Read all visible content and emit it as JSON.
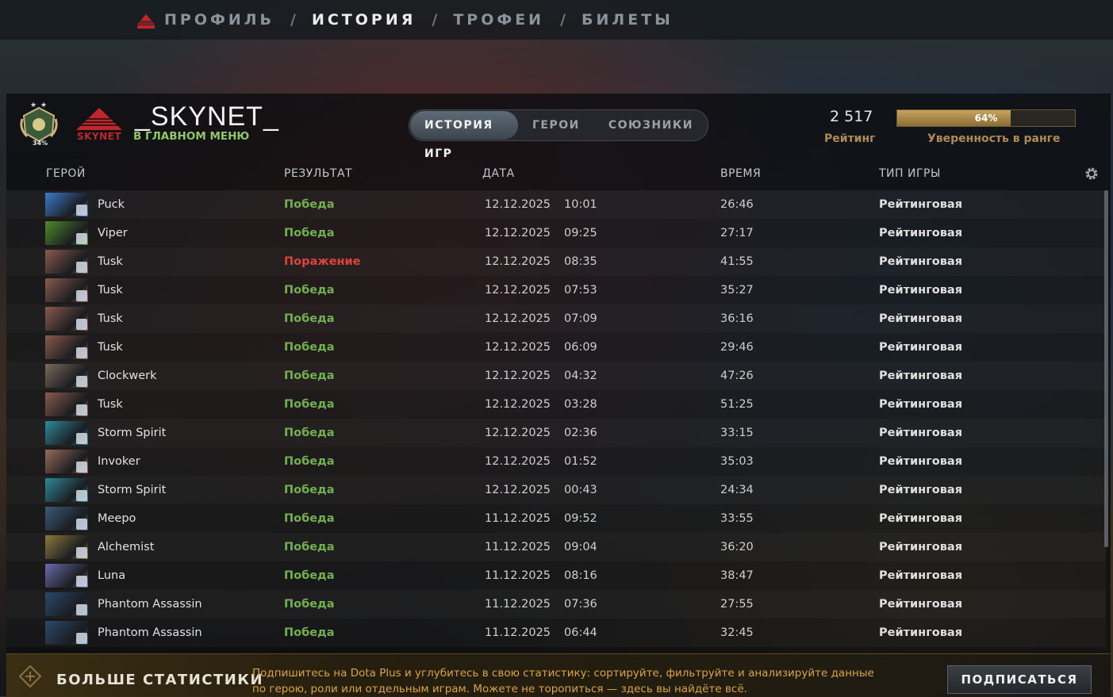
{
  "nav": {
    "items": [
      {
        "label": "ПРОФИЛЬ",
        "active": false
      },
      {
        "label": "ИСТОРИЯ",
        "active": true
      },
      {
        "label": "ТРОФЕИ",
        "active": false
      },
      {
        "label": "БИЛЕТЫ",
        "active": false
      }
    ],
    "separator": "/"
  },
  "player": {
    "name": "_SKYNET_",
    "status": "В ГЛАВНОМ МЕНЮ",
    "team_logo_text": "SKYNET",
    "medal_stars": 2,
    "medal_percent": "34%"
  },
  "tabs": [
    {
      "label": "ИСТОРИЯ ИГР",
      "active": true
    },
    {
      "label": "ГЕРОИ",
      "active": false
    },
    {
      "label": "СОЮЗНИКИ",
      "active": false
    }
  ],
  "rating": {
    "value": "2 517",
    "label": "Рейтинг"
  },
  "confidence": {
    "value": 0.64,
    "text": "64%",
    "label": "Уверенность в ранге"
  },
  "columns": {
    "hero": "ГЕРОЙ",
    "result": "РЕЗУЛЬТАТ",
    "date": "ДАТА",
    "duration": "ВРЕМЯ",
    "type": "ТИП ИГРЫ"
  },
  "matches": [
    {
      "hero": "Puck",
      "result": "Победа",
      "win": true,
      "date": "12.12.2025",
      "time": "10:01",
      "duration": "26:46",
      "type": "Рейтинговая",
      "color": "#3d7cc9"
    },
    {
      "hero": "Viper",
      "result": "Победа",
      "win": true,
      "date": "12.12.2025",
      "time": "09:25",
      "duration": "27:17",
      "type": "Рейтинговая",
      "color": "#4f8a2a"
    },
    {
      "hero": "Tusk",
      "result": "Поражение",
      "win": false,
      "date": "12.12.2025",
      "time": "08:35",
      "duration": "41:55",
      "type": "Рейтинговая",
      "color": "#8a5a4e"
    },
    {
      "hero": "Tusk",
      "result": "Победа",
      "win": true,
      "date": "12.12.2025",
      "time": "07:53",
      "duration": "35:27",
      "type": "Рейтинговая",
      "color": "#8a5a4e"
    },
    {
      "hero": "Tusk",
      "result": "Победа",
      "win": true,
      "date": "12.12.2025",
      "time": "07:09",
      "duration": "36:16",
      "type": "Рейтинговая",
      "color": "#8a5a4e"
    },
    {
      "hero": "Tusk",
      "result": "Победа",
      "win": true,
      "date": "12.12.2025",
      "time": "06:09",
      "duration": "29:46",
      "type": "Рейтинговая",
      "color": "#8a5a4e"
    },
    {
      "hero": "Clockwerk",
      "result": "Победа",
      "win": true,
      "date": "12.12.2025",
      "time": "04:32",
      "duration": "47:26",
      "type": "Рейтинговая",
      "color": "#7a6a5a"
    },
    {
      "hero": "Tusk",
      "result": "Победа",
      "win": true,
      "date": "12.12.2025",
      "time": "03:28",
      "duration": "51:25",
      "type": "Рейтинговая",
      "color": "#8a5a4e"
    },
    {
      "hero": "Storm Spirit",
      "result": "Победа",
      "win": true,
      "date": "12.12.2025",
      "time": "02:36",
      "duration": "33:15",
      "type": "Рейтинговая",
      "color": "#2d8a9a"
    },
    {
      "hero": "Invoker",
      "result": "Победа",
      "win": true,
      "date": "12.12.2025",
      "time": "01:52",
      "duration": "35:03",
      "type": "Рейтинговая",
      "color": "#9a6a5a"
    },
    {
      "hero": "Storm Spirit",
      "result": "Победа",
      "win": true,
      "date": "12.12.2025",
      "time": "00:43",
      "duration": "24:34",
      "type": "Рейтинговая",
      "color": "#2d8a9a"
    },
    {
      "hero": "Meepo",
      "result": "Победа",
      "win": true,
      "date": "11.12.2025",
      "time": "09:52",
      "duration": "33:55",
      "type": "Рейтинговая",
      "color": "#3a5a7a"
    },
    {
      "hero": "Alchemist",
      "result": "Победа",
      "win": true,
      "date": "11.12.2025",
      "time": "09:04",
      "duration": "36:20",
      "type": "Рейтинговая",
      "color": "#8a7a3a"
    },
    {
      "hero": "Luna",
      "result": "Победа",
      "win": true,
      "date": "11.12.2025",
      "time": "08:16",
      "duration": "38:47",
      "type": "Рейтинговая",
      "color": "#6a6aaa"
    },
    {
      "hero": "Phantom Assassin",
      "result": "Победа",
      "win": true,
      "date": "11.12.2025",
      "time": "07:36",
      "duration": "27:55",
      "type": "Рейтинговая",
      "color": "#2a4a6a"
    },
    {
      "hero": "Phantom Assassin",
      "result": "Победа",
      "win": true,
      "date": "11.12.2025",
      "time": "06:44",
      "duration": "32:45",
      "type": "Рейтинговая",
      "color": "#2a4a6a"
    }
  ],
  "promo": {
    "title": "БОЛЬШЕ СТАТИСТИКИ",
    "text": "Подпишитесь на Dota Plus и углубитесь в свою статистику: сортируйте, фильтруйте и анализируйте данные по герою, роли или отдельным играм. Можете не торопиться — здесь вы найдёте всё.",
    "button": "ПОДПИСАТЬСЯ"
  },
  "colors": {
    "win": "#72b04f",
    "loss": "#d9443b",
    "accent_gold": "#b08a53",
    "status_green": "#8fc76a"
  }
}
